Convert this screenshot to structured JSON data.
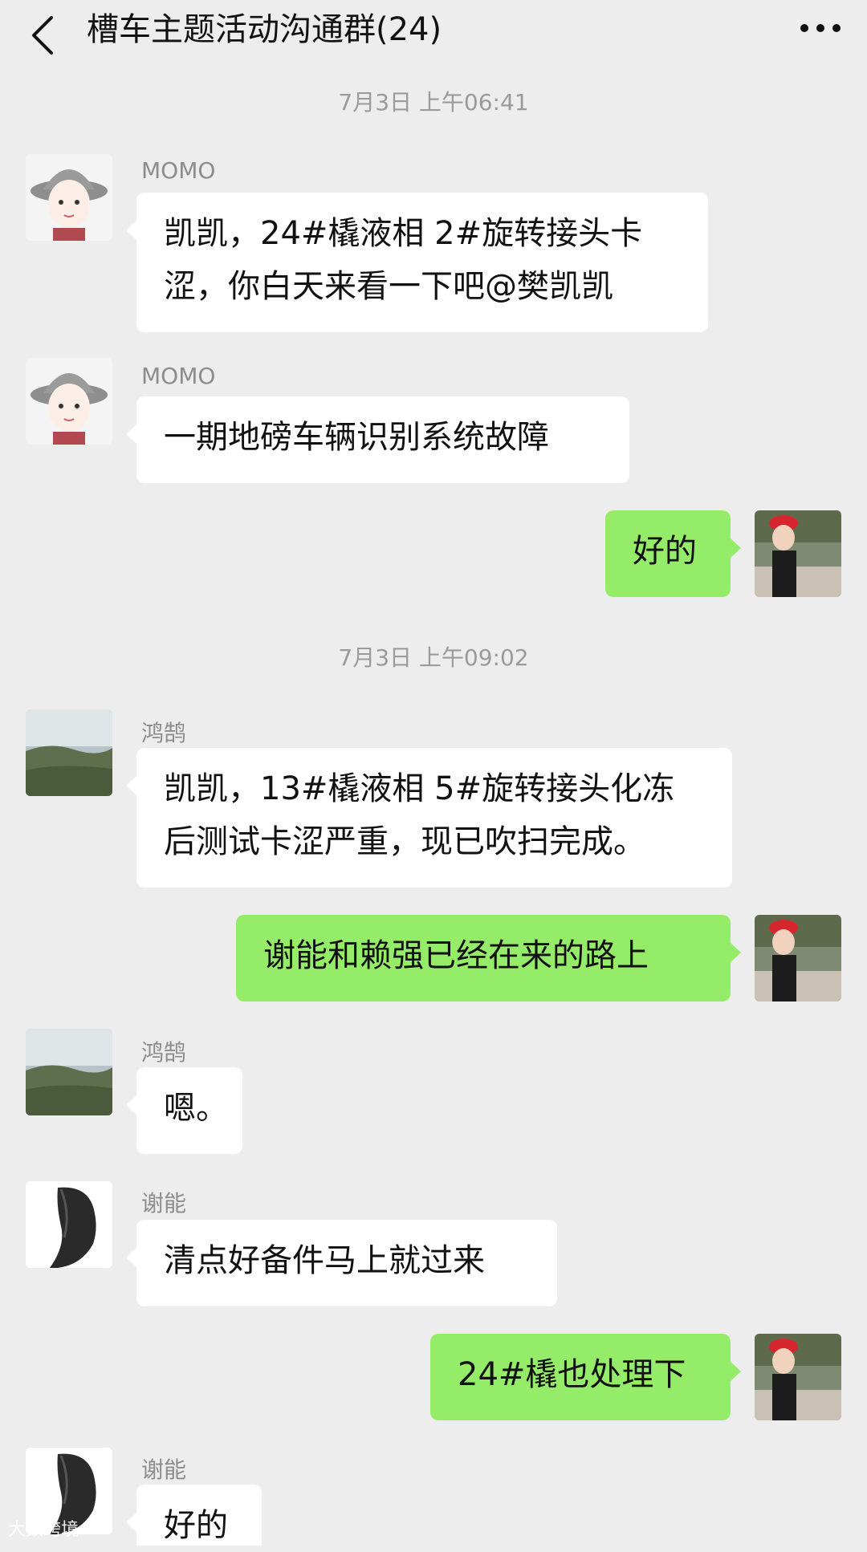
{
  "header": {
    "title": "槽车主题活动沟通群(24)",
    "back_icon": "chevron-left-icon",
    "more_icon": "more-dots-icon"
  },
  "colors": {
    "background": "#ededed",
    "outgoing_bubble": "#95ec69",
    "incoming_bubble": "#ffffff"
  },
  "timestamps": [
    "7月3日 上午06:41",
    "7月3日 上午09:02"
  ],
  "messages": [
    {
      "sender": "MOMO",
      "direction": "in",
      "lines": [
        "凯凯，24#橇液相 2#旋转接头卡",
        "涩，你白天来看一下吧@樊凯凯"
      ]
    },
    {
      "sender": "MOMO",
      "direction": "in",
      "lines": [
        "一期地磅车辆识别系统故障"
      ]
    },
    {
      "sender": "",
      "direction": "out",
      "lines": [
        "好的"
      ]
    },
    {
      "sender": "鸿鹄",
      "direction": "in",
      "lines": [
        "凯凯，13#橇液相 5#旋转接头化冻",
        "后测试卡涩严重，现已吹扫完成。"
      ]
    },
    {
      "sender": "",
      "direction": "out",
      "lines": [
        "谢能和赖强已经在来的路上"
      ]
    },
    {
      "sender": "鸿鹄",
      "direction": "in",
      "lines": [
        "嗯。"
      ]
    },
    {
      "sender": "谢能",
      "direction": "in",
      "lines": [
        "清点好备件马上就过来"
      ]
    },
    {
      "sender": "",
      "direction": "out",
      "lines": [
        "24#橇也处理下"
      ]
    },
    {
      "sender": "谢能",
      "direction": "in",
      "lines": [
        "好的"
      ]
    }
  ],
  "watermark": "大数跨境"
}
